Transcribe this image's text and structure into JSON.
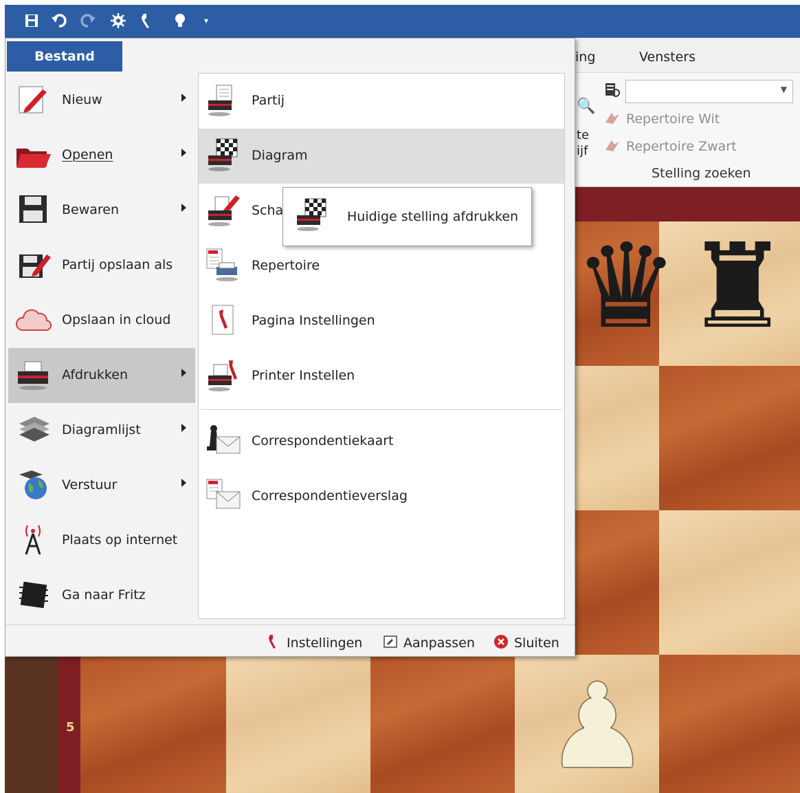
{
  "quick_access": {
    "icons": [
      "save-icon",
      "undo-icon",
      "redo-icon",
      "engine-icon",
      "wrench-icon",
      "idea-icon",
      "customize-icon"
    ]
  },
  "ribbon": {
    "tabs_visible": [
      "ing",
      "Vensters"
    ],
    "partial_labels": [
      "te",
      "ijf"
    ],
    "search_field": {
      "value": ""
    },
    "repertoire_white": "Repertoire Wit",
    "repertoire_black": "Repertoire Zwart",
    "group_label": "Stelling zoeken"
  },
  "board": {
    "rank_label": "5",
    "pieces": [
      "black-queen",
      "black-rook",
      "white-pawn"
    ]
  },
  "menu": {
    "tab_label": "Bestand",
    "left_items": [
      {
        "label": "Nieuw",
        "icon": "new-icon",
        "submenu": true
      },
      {
        "label": "Openen",
        "icon": "folder-icon",
        "submenu": true
      },
      {
        "label": "Bewaren",
        "icon": "save-icon",
        "submenu": true
      },
      {
        "label": "Partij opslaan als",
        "icon": "save-as-icon",
        "submenu": false
      },
      {
        "label": "Opslaan in cloud",
        "icon": "cloud-icon",
        "submenu": false
      },
      {
        "label": "Afdrukken",
        "icon": "printer-icon",
        "submenu": true,
        "active": true
      },
      {
        "label": "Diagramlijst",
        "icon": "diagram-list-icon",
        "submenu": true
      },
      {
        "label": "Verstuur",
        "icon": "globe-icon",
        "submenu": true
      },
      {
        "label": "Plaats op internet",
        "icon": "antenna-icon",
        "submenu": false
      },
      {
        "label": "Ga naar Fritz",
        "icon": "chip-icon",
        "submenu": false
      }
    ],
    "right_items": [
      {
        "label": "Partij",
        "icon": "print-game-icon"
      },
      {
        "label": "Diagram",
        "icon": "print-diagram-icon",
        "hover": true
      },
      {
        "label": "Scha",
        "icon": "print-edit-icon"
      },
      {
        "label": "Repertoire",
        "icon": "print-repertoire-icon"
      },
      {
        "label": "Pagina Instellingen",
        "icon": "page-settings-icon"
      },
      {
        "label": "Printer Instellen",
        "icon": "printer-settings-icon"
      },
      {
        "label": "Correspondentiekaart",
        "icon": "correspondence-card-icon"
      },
      {
        "label": "Correspondentieverslag",
        "icon": "correspondence-report-icon"
      }
    ],
    "popup": {
      "label": "Huidige stelling afdrukken",
      "icon": "print-position-icon"
    },
    "footer": {
      "settings": "Instellingen",
      "customize": "Aanpassen",
      "close": "Sluiten"
    }
  },
  "colors": {
    "title_bar": "#2d5ea5",
    "active_item": "#c8c8c8",
    "hover_item": "#dedede"
  }
}
